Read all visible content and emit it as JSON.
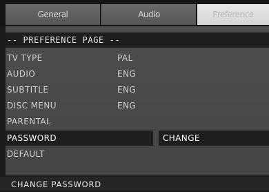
{
  "tabs": [
    {
      "label": "General"
    },
    {
      "label": "Audio"
    },
    {
      "label": "Preference"
    }
  ],
  "page": {
    "header": "-- PREFERENCE PAGE --"
  },
  "settings": [
    {
      "label": "TV TYPE",
      "value": "PAL"
    },
    {
      "label": "AUDIO",
      "value": "ENG"
    },
    {
      "label": "SUBTITLE",
      "value": "ENG"
    },
    {
      "label": "DISC MENU",
      "value": "ENG"
    },
    {
      "label": "PARENTAL",
      "value": ""
    },
    {
      "label": "PASSWORD",
      "value": ""
    },
    {
      "label": "DEFAULT",
      "value": ""
    }
  ],
  "password_option": "CHANGE",
  "status": "CHANGE PASSWORD",
  "colors": {
    "background": "#1a1a1a",
    "panel": "#4a4a4a",
    "selection": "#1e1e1e",
    "text": "#d0d0d0"
  }
}
